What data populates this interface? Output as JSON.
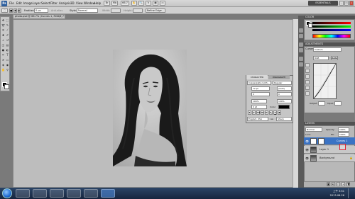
{
  "app": {
    "logo": "Ps",
    "workspace": "ESSENTIALS",
    "window_buttons": [
      "_",
      "□",
      "x"
    ]
  },
  "menubar": {
    "items": [
      "File",
      "Edit",
      "Image",
      "Layer",
      "Select",
      "Filter",
      "Analysis",
      "3D",
      "View",
      "Window",
      "Help"
    ],
    "zoom": "66.7"
  },
  "options": {
    "feather_label": "Feather:",
    "feather_value": "0 px",
    "antialias_label": "Anti-alias",
    "style_label": "Style:",
    "style_value": "Normal",
    "width_label": "Width:",
    "height_label": "Height:",
    "refine_label": "Refine Edge..."
  },
  "document": {
    "tab_title": "photo.psd @ 66.7% (Curves 1, RGB/8) *",
    "status": "66.67%   Doc: 1.48M/2.78M"
  },
  "color_panel": {
    "tabs": [
      "COLOR",
      "SWATCHES",
      "STYLES"
    ]
  },
  "adjustments_panel": {
    "title": "ADJUSTMENTS",
    "preset_label": "Curves",
    "preset_value": "Custom",
    "channel_value": "RGB",
    "output_label": "Output:",
    "input_label": "Input:",
    "auto_label": "Auto"
  },
  "character_panel": {
    "tabs": [
      "CHARACTER",
      "PARAGRAPH"
    ],
    "font_family": "Copperplate Goth...",
    "font_style": "Regular",
    "font_size": "72 pt",
    "leading": "(Auto)",
    "kerning": "0",
    "tracking": "0",
    "vscale": "100%",
    "hscale": "100%",
    "baseline": "0 pt",
    "color_label": "Color:",
    "style_buttons": [
      "T",
      "T",
      "TT",
      "Tr",
      "T'",
      "T,",
      "T",
      "T"
    ],
    "language": "English: USA",
    "aa": "aa",
    "aa_mode": "Sharp"
  },
  "layers_panel": {
    "tabs": [
      "LAYERS",
      "CHANNELS",
      "PATHS"
    ],
    "blend_mode": "Normal",
    "opacity_label": "Opacity:",
    "opacity_value": "100%",
    "lock_label": "Lock:",
    "fill_label": "Fill:",
    "fill_value": "100%",
    "layers": [
      {
        "name": "Curves 1",
        "selected": true
      },
      {
        "name": "Layer 1",
        "selected": false
      },
      {
        "name": "Background",
        "selected": false
      }
    ]
  },
  "taskbar": {
    "time": "上午 3:51",
    "date": "2013-06-26"
  },
  "colors": {
    "selection_blue": "#3b73c4",
    "panel_bg": "#b8b8b8",
    "canvas_bg": "#bdbdbd"
  }
}
